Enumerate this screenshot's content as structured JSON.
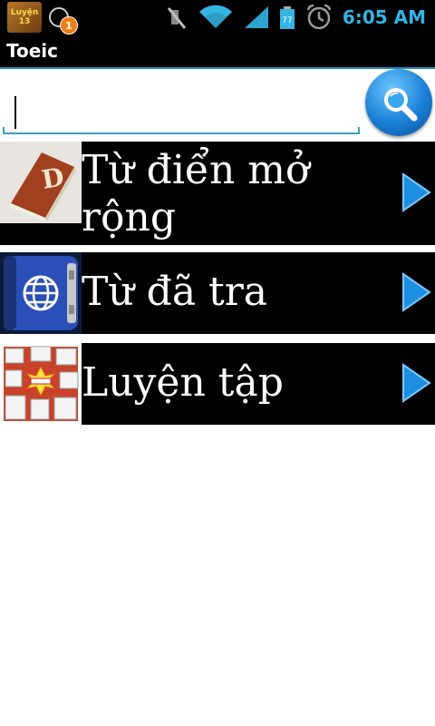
{
  "status_bar": {
    "app_icon_text": "Luyện 13",
    "notification_count": "1",
    "battery_level": "77",
    "time": "6:05 AM",
    "icons": [
      "muted-icon",
      "wifi-icon",
      "signal-icon",
      "battery-icon",
      "alarm-icon"
    ]
  },
  "title_bar": {
    "title": "Toeic"
  },
  "search": {
    "value": "",
    "placeholder": "",
    "button_icon": "search-icon"
  },
  "menu": {
    "items": [
      {
        "label": "Từ điển mở rộng",
        "icon": "dictionary-book-icon",
        "arrow": "play-arrow-icon"
      },
      {
        "label": "Từ đã tra",
        "icon": "globe-book-icon",
        "arrow": "play-arrow-icon"
      },
      {
        "label": "Luyện tập",
        "icon": "exercise-collage-icon",
        "arrow": "play-arrow-icon"
      }
    ]
  },
  "colors": {
    "accent": "#33b5e5",
    "menu_background": "#000000",
    "arrow_blue": "#1e8fe0"
  }
}
